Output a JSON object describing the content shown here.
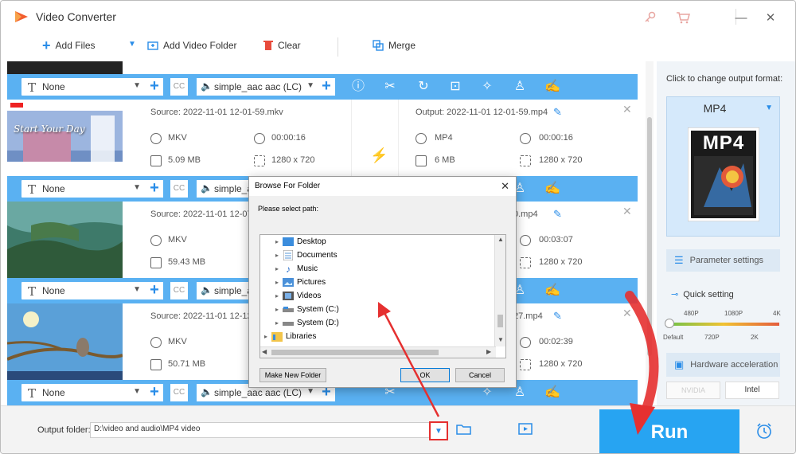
{
  "app": {
    "title": "Video Converter"
  },
  "toolbar": {
    "add_files": "Add Files",
    "add_video_folder": "Add Video Folder",
    "clear": "Clear",
    "merge": "Merge"
  },
  "rows": [
    {
      "source": "Source: 2022-11-01 12-01-59.mkv",
      "output": "Output: 2022-11-01 12-01-59.mp4",
      "src_format": "MKV",
      "src_duration": "00:00:16",
      "src_size": "5.09 MB",
      "src_resolution": "1280 x 720",
      "out_format": "MP4",
      "out_duration": "00:00:16",
      "out_size": "6 MB",
      "out_resolution": "1280 x 720",
      "thumb_text": "Start Your Day"
    },
    {
      "source": "Source: 2022-11-01 12-07",
      "output": "0.mp4",
      "src_format": "MKV",
      "src_size": "59.43 MB",
      "out_duration": "00:03:07",
      "out_resolution": "1280 x 720"
    },
    {
      "source": "Source: 2022-11-01 12-12",
      "output": "27.mp4",
      "src_format": "MKV",
      "src_size": "50.71 MB",
      "out_duration": "00:02:39",
      "out_resolution": "1280 x 720"
    }
  ],
  "opbar": {
    "subtitle": "None",
    "audio": "simple_aac aac (LC)",
    "audio_short": "simple_a"
  },
  "side": {
    "change_format_label": "Click to change output format:",
    "format": "MP4",
    "format_badge": "MP4",
    "parameter_settings": "Parameter settings",
    "quick_setting": "Quick setting",
    "quality_labels_top": [
      "480P",
      "1080P",
      "4K"
    ],
    "quality_labels_bottom": [
      "Default",
      "720P",
      "2K"
    ],
    "hardware_acceleration": "Hardware acceleration",
    "nvidia": "NVIDIA",
    "intel": "Intel"
  },
  "bottom": {
    "output_folder_label": "Output folder:",
    "output_folder_value": "D:\\video and audio\\MP4 video",
    "run": "Run"
  },
  "dialog": {
    "title": "Browse For Folder",
    "prompt": "Please select path:",
    "tree": [
      "Desktop",
      "Documents",
      "Music",
      "Pictures",
      "Videos",
      "System (C:)",
      "System (D:)",
      "Libraries"
    ],
    "new_folder": "Make New Folder",
    "ok": "OK",
    "cancel": "Cancel"
  },
  "colors": {
    "accent": "#27a4f2",
    "opbar": "#5ab1f2",
    "annotation": "#e53030"
  }
}
